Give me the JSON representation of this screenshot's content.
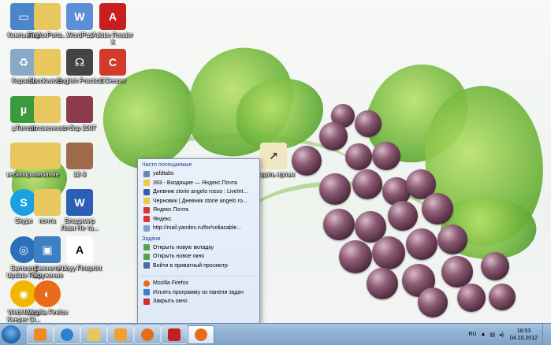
{
  "desktop_icons": [
    {
      "label": "Компьютер",
      "icon": "computer-icon",
      "color": "#4a86c8"
    },
    {
      "label": "FirefoxPorta...",
      "icon": "folder-icon",
      "color": "#e7c75e"
    },
    {
      "label": "WordPad",
      "icon": "wordpad-icon",
      "color": "#5d8fd6"
    },
    {
      "label": "Adobe Reader X",
      "icon": "adobe-reader-icon",
      "color": "#c81e1e"
    },
    {
      "label": "Корзина",
      "icon": "recycle-bin-icon",
      "color": "#8aa8c8"
    },
    {
      "label": "Shockwave...",
      "icon": "folder-icon",
      "color": "#e7c75e"
    },
    {
      "label": "English Practice",
      "icon": "headphones-icon",
      "color": "#444444"
    },
    {
      "label": "CCleaner",
      "icon": "ccleaner-icon",
      "color": "#d23a2a"
    },
    {
      "label": "µTorrent",
      "icon": "utorrent-icon",
      "color": "#3b9a3b"
    },
    {
      "label": "отложенное",
      "icon": "folder-icon",
      "color": "#e7c75e"
    },
    {
      "label": "отбор 2007",
      "icon": "photo-icon",
      "color": "#8b3b4b"
    },
    {
      "label": "вебинары...",
      "icon": "folder-icon",
      "color": "#e7c75e"
    },
    {
      "label": "вязание",
      "icon": "folder-icon",
      "color": "#e7c75e"
    },
    {
      "label": "12-3",
      "icon": "photo-icon",
      "color": "#9d6a4c"
    },
    {
      "label": "создать ярлык",
      "icon": "shortcut-icon",
      "color": "#f0e6c0"
    },
    {
      "label": "Skype",
      "icon": "skype-icon",
      "color": "#1ba0e0"
    },
    {
      "label": "почта",
      "icon": "folder-icon",
      "color": "#e7c75e"
    },
    {
      "label": "Владимир Леви Не та...",
      "icon": "word-doc-icon",
      "color": "#2b5fb5"
    },
    {
      "label": "Samsung Update Plus",
      "icon": "globe-icon",
      "color": "#2d6fb8"
    },
    {
      "label": "Сменить окружение",
      "icon": "monitor-icon",
      "color": "#3e7fc2"
    },
    {
      "label": "Abbyy Fineprint",
      "icon": "font-icon",
      "color": "#ffffff"
    },
    {
      "label": "WebMoney Keeper Cl...",
      "icon": "webmoney-icon",
      "color": "#f2b600"
    },
    {
      "label": "Mozilla Firefox",
      "icon": "firefox-icon",
      "color": "#e86b1a"
    }
  ],
  "jumplist": {
    "frequent_header": "Часто посещаемые",
    "frequent": [
      {
        "label": "yafdtabs",
        "color": "#6a86b8"
      },
      {
        "label": "393 - Входящие — Яндекс.Почта",
        "color": "#f3c93a"
      },
      {
        "label": "Дневник storie angelo rosso : LiveInt...",
        "color": "#2f62a8"
      },
      {
        "label": "Черновик | Дневник storie angelo ro...",
        "color": "#f3c93a"
      },
      {
        "label": "Яндекс.Почта",
        "color": "#d33"
      },
      {
        "label": "Яндекс",
        "color": "#d33"
      },
      {
        "label": "http://mail.yandex.ru/for/voliacable...",
        "color": "#7da0d0"
      }
    ],
    "tasks_header": "Задачи",
    "tasks": [
      {
        "label": "Открыть новую вкладку",
        "color": "#5aa04a"
      },
      {
        "label": "Открыть новое окно",
        "color": "#5aa04a"
      },
      {
        "label": "Войти в приватный просмотр",
        "color": "#4a6aa0"
      }
    ],
    "actions": [
      {
        "label": "Mozilla Firefox",
        "color": "#e86b1a"
      },
      {
        "label": "Изъять программу из панели задач",
        "color": "#3a7fcf"
      },
      {
        "label": "Закрыть окно",
        "color": "#c0342c"
      }
    ]
  },
  "taskbar": {
    "buttons": [
      {
        "name": "taskbar-xampp",
        "icon": "xampp-icon",
        "color": "#f08a24"
      },
      {
        "name": "taskbar-ie",
        "icon": "ie-icon",
        "color": "#2d7fd2"
      },
      {
        "name": "taskbar-explorer",
        "icon": "folder-icon",
        "color": "#e7c75e"
      },
      {
        "name": "taskbar-media-player",
        "icon": "media-player-icon",
        "color": "#f0a030"
      },
      {
        "name": "taskbar-firefox",
        "icon": "firefox-icon",
        "color": "#e86b1a"
      },
      {
        "name": "taskbar-acrobat",
        "icon": "adobe-reader-icon",
        "color": "#c81e1e"
      },
      {
        "name": "taskbar-firefox-active",
        "icon": "firefox-icon",
        "color": "#e86b1a"
      }
    ],
    "language": "RU",
    "time": "18:53",
    "date": "04.10.2012"
  }
}
